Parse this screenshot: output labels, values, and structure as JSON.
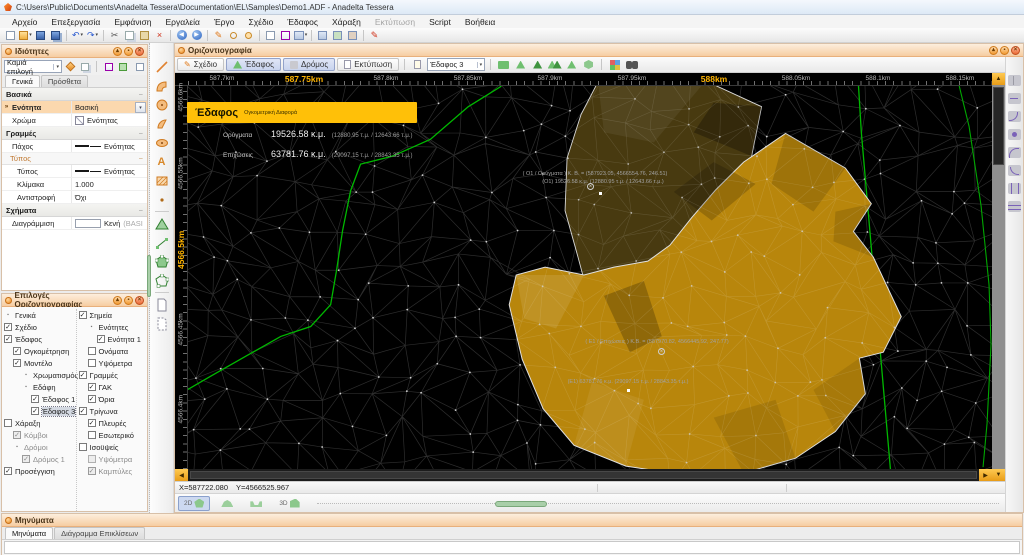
{
  "window": {
    "title": "C:\\Users\\Public\\Documents\\Anadelta Tessera\\Documentation\\EL\\Samples\\Demo1.ADF - Anadelta Tessera"
  },
  "menu": {
    "items": [
      {
        "label": "Αρχείο"
      },
      {
        "label": "Επεξεργασία"
      },
      {
        "label": "Εμφάνιση"
      },
      {
        "label": "Εργαλεία"
      },
      {
        "label": "Έργο"
      },
      {
        "label": "Σχέδιο"
      },
      {
        "label": "Έδαφος"
      },
      {
        "label": "Χάραξη"
      },
      {
        "label": "Εκτύπωση",
        "disabled": "1"
      },
      {
        "label": "Script"
      },
      {
        "label": "Βοήθεια"
      }
    ]
  },
  "icons": {
    "undo": "↶",
    "redo": "↷",
    "cut": "✂",
    "delete": "×",
    "pencil": "✎",
    "back": "◀",
    "forward": "▶",
    "dropdown": "▾",
    "panel_collapse": "▴",
    "panel_pin": "▪",
    "panel_close": "×",
    "text_tool": "A",
    "section_minus": "−",
    "scroll_up": "▲",
    "scroll_down": "▼",
    "scroll_left": "◀",
    "scroll_right": "▶"
  },
  "props": {
    "title": "Ιδιότητες",
    "combo": "Καμιά επιλογή",
    "tabs": [
      {
        "label": "Γενικά"
      },
      {
        "label": "Πρόσθετα"
      }
    ],
    "sec_basic": "Βασικά",
    "sec_lines": "Γραμμές",
    "sec_shapes": "Σχήματα",
    "sub_type": "Τύπος",
    "rows": {
      "enotita": {
        "label": "Ενότητα",
        "value": "Βασική"
      },
      "xroma": {
        "label": "Χρώμα",
        "value": "Ενότητας"
      },
      "paxos": {
        "label": "Πάχος",
        "value": "Ενότητας"
      },
      "typos": {
        "label": "Τύπος",
        "value": "Ενότητας"
      },
      "klimaka": {
        "label": "Κλίμακα",
        "value": "1.000"
      },
      "antistrofi": {
        "label": "Αντιστροφή",
        "value": "Όχι"
      },
      "diagrammisi": {
        "label": "Διαγράμμιση",
        "value": "Κενή",
        "hint": "(BASI"
      }
    }
  },
  "opts": {
    "title": "Επιλογές Οριζοντιογραφίας",
    "left": [
      {
        "label": "Γενικά",
        "check": "bullet",
        "lvl": "0"
      },
      {
        "label": "Σχέδιο",
        "check": "checked",
        "lvl": "0"
      },
      {
        "label": "Έδαφος",
        "check": "checked",
        "lvl": "0"
      },
      {
        "label": "Ογκομέτρηση",
        "check": "checked",
        "lvl": "1"
      },
      {
        "label": "Μοντέλο",
        "check": "checked",
        "lvl": "1"
      },
      {
        "label": "Χρωματισμός",
        "check": "bullet",
        "lvl": "2"
      },
      {
        "label": "Εδάφη",
        "check": "bullet",
        "lvl": "2"
      },
      {
        "label": "Έδαφος 1",
        "check": "checked",
        "lvl": "3"
      },
      {
        "label": "Έδαφος 3",
        "check": "checked",
        "lvl": "3",
        "sel": "1"
      },
      {
        "label": "Χάραξη",
        "check": "unchecked",
        "lvl": "0"
      },
      {
        "label": "Κόμβοι",
        "check": "checked-gray",
        "lvl": "1",
        "gray": "1"
      },
      {
        "label": "Δρόμοι",
        "check": "bullet",
        "lvl": "1",
        "gray": "1"
      },
      {
        "label": "Δρόμος 1",
        "check": "checked-gray",
        "lvl": "2",
        "gray": "1"
      },
      {
        "label": "Προσέγγιση",
        "check": "checked",
        "lvl": "0"
      }
    ],
    "right": [
      {
        "label": "Σημεία",
        "check": "checked",
        "lvl": "0"
      },
      {
        "label": "Ενότητες",
        "check": "bullet",
        "lvl": "1"
      },
      {
        "label": "Ενότητα 1",
        "check": "checked",
        "lvl": "2"
      },
      {
        "label": "Ονόματα",
        "check": "unchecked",
        "lvl": "1"
      },
      {
        "label": "Υψόμετρα",
        "check": "unchecked",
        "lvl": "1"
      },
      {
        "label": "Γραμμές",
        "check": "checked",
        "lvl": "0"
      },
      {
        "label": "ΓΑΚ",
        "check": "checked",
        "lvl": "1"
      },
      {
        "label": "Όρια",
        "check": "checked",
        "lvl": "1"
      },
      {
        "label": "Τρίγωνα",
        "check": "checked",
        "lvl": "0"
      },
      {
        "label": "Πλευρές",
        "check": "checked",
        "lvl": "1"
      },
      {
        "label": "Εσωτερικό",
        "check": "unchecked",
        "lvl": "1"
      },
      {
        "label": "Ισοϋψείς",
        "check": "unchecked",
        "lvl": "0"
      },
      {
        "label": "Υψόμετρα",
        "check": "unchecked-gray",
        "lvl": "1",
        "gray": "1"
      },
      {
        "label": "Καμπύλες",
        "check": "checked-gray",
        "lvl": "1",
        "gray": "1"
      }
    ]
  },
  "canvas_win": {
    "title": "Οριζοντιογραφία",
    "tabs": [
      {
        "label": "Σχέδιο"
      },
      {
        "label": "Έδαφος"
      },
      {
        "label": "Δρόμος"
      },
      {
        "label": "Εκτύπωση"
      }
    ],
    "terrain_combo": "Έδαφος 3"
  },
  "ruler_x": [
    {
      "t": "587.7km"
    },
    {
      "t": "587.75km",
      "hl": "1"
    },
    {
      "t": "587.8km"
    },
    {
      "t": "587.85km"
    },
    {
      "t": "587.9km"
    },
    {
      "t": "587.95km"
    },
    {
      "t": "588km",
      "hl": "1"
    },
    {
      "t": "588.05km"
    },
    {
      "t": "588.1km"
    },
    {
      "t": "588.15km"
    }
  ],
  "ruler_y": [
    {
      "t": "4566.6km"
    },
    {
      "t": "4566.55km"
    },
    {
      "t": "4566.5km",
      "hl": "1"
    },
    {
      "t": "4566.45km"
    },
    {
      "t": "4566.4km"
    }
  ],
  "banner": {
    "title": "Έδαφος",
    "subtitle": "Ογκομετρική Διαφορά",
    "rows": [
      {
        "label": "Ορύγματα",
        "value": "19526.58 κ.μ.",
        "detail": "(12880.95 τ.μ. / 12643.66 τ.μ.)"
      },
      {
        "label": "Επιχώσεις",
        "value": "63781.76 κ.μ.",
        "detail": "(29097.15 τ.μ. / 28843.35 τ.μ.)"
      }
    ]
  },
  "annotations": {
    "o1_header": "( Ο1 / Ορύγματα ) Κ. Β. = (587923.05, 4566554.76, 246.51)",
    "o1_value": "(Ο1) 19526.58 κ.μ.  (12880.95 τ.μ. / 12643.66 τ.μ.)",
    "e1_header": "( Ε1 / Επιχώσεις ) Κ.Β. = (587970.82, 4566445.92, 247.77)",
    "e1_value": "(Ε1) 63781.76 κ.μ.  (29097.15 τ.μ. / 28843.35 τ.μ.)"
  },
  "status": {
    "x": "X=587722.080",
    "y": "Y=4566525.967"
  },
  "viewbar": {
    "d2": "2D",
    "d3": "3D"
  },
  "messages": {
    "title": "Μηνύματα",
    "tabs": [
      {
        "label": "Μηνύματα"
      },
      {
        "label": "Διάγραμμα Επικλίσεων"
      }
    ]
  },
  "colors": {
    "banner_yellow": "#ffc008",
    "terrain_fill": "#b8860c",
    "terrain_cut": "#483a10",
    "boundary_green": "#00b800",
    "ruler_highlight": "#ffb400",
    "accent_orange": "#f5a623"
  }
}
